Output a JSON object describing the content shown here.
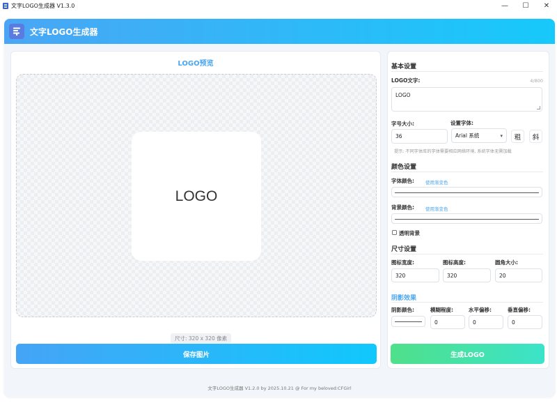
{
  "window": {
    "title": "文字LOGO生成器 V1.3.0",
    "minimize_glyph": "—",
    "maximize_glyph": "☐",
    "close_glyph": "✕"
  },
  "header": {
    "title": "文字LOGO生成器",
    "icon": "text-logo-icon",
    "gradient": [
      "#4aa6f5",
      "#17c9fb"
    ]
  },
  "preview": {
    "title": "LOGO预览",
    "logo_text": "LOGO",
    "size_caption": "尺寸: 320 x 320 像素",
    "save_label": "保存图片"
  },
  "basic": {
    "title": "基本设置",
    "text_label": "LOGO文字:",
    "counter": "4/800",
    "text_value": "LOGO",
    "size_label": "字号大小:",
    "size_value": "36",
    "font_label": "设置字体:",
    "font_value": "Arial 系统",
    "bold_label": "粗",
    "italic_label": "斜",
    "hint": "提示: 不同字体库的字体需要相应网络环境, 系统字体无需加载"
  },
  "colors": {
    "title": "颜色设置",
    "font_color_label": "字体颜色:",
    "font_gradient_link": "使用渐变色",
    "bg_color_label": "背景颜色:",
    "bg_gradient_link": "使用渐变色",
    "transparent_label": "透明背景"
  },
  "dimensions": {
    "title": "尺寸设置",
    "width_label": "图标宽度:",
    "width_value": "320",
    "height_label": "图标高度:",
    "height_value": "320",
    "radius_label": "圆角大小:",
    "radius_value": "20"
  },
  "shadow": {
    "title": "阴影效果",
    "color_label": "阴影颜色:",
    "blur_label": "模糊程度:",
    "blur_value": "0",
    "offset_x_label": "水平偏移:",
    "offset_x_value": "0",
    "offset_y_label": "垂直偏移:",
    "offset_y_value": "0"
  },
  "generate_label": "生成LOGO",
  "footer": "文字LOGO生成器 V1.2.0 by 2025.10.21 @ For my beloved:CFGirl",
  "accent_color": "#4aa6f0",
  "generate_gradient": [
    "#4fe08a",
    "#3be3c9"
  ]
}
